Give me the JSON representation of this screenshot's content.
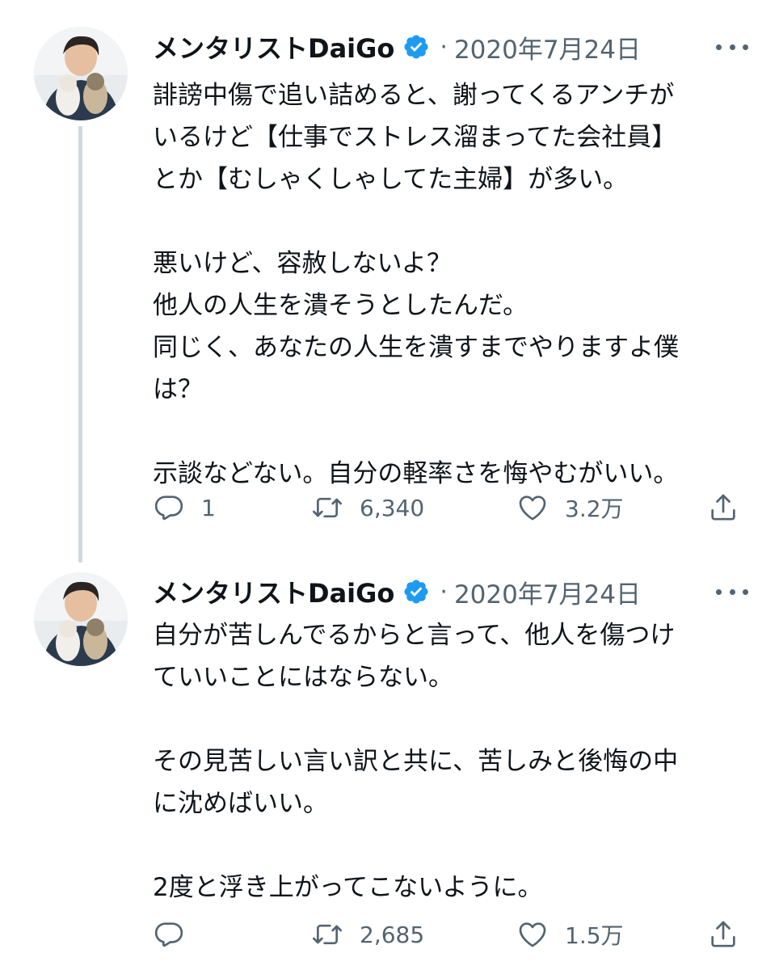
{
  "tweets": [
    {
      "author": "メンタリストDaiGo",
      "separator": "·",
      "date": "2020年7月24日",
      "lines": [
        "誹謗中傷で追い詰めると、謝ってくるアンチが",
        "いるけど【仕事でストレス溜まってた会社員】",
        "とか【むしゃくしゃしてた主婦】が多い。",
        "",
        "悪いけど、容赦しないよ？",
        "他人の人生を潰そうとしたんだ。",
        "同じく、あなたの人生を潰すまでやりますよ僕",
        "は？",
        "",
        "示談などない。自分の軽率さを悔やむがいい。"
      ],
      "replies": "1",
      "retweets": "6,340",
      "likes": "3.2万"
    },
    {
      "author": "メンタリストDaiGo",
      "separator": "·",
      "date": "2020年7月24日",
      "lines": [
        "自分が苦しんでるからと言って、他人を傷つけ",
        "ていいことにはならない。",
        "",
        "その見苦しい言い訳と共に、苦しみと後悔の中",
        "に沈めばいい。",
        "",
        "2度と浮き上がってこないように。"
      ],
      "replies": "",
      "retweets": "2,685",
      "likes": "1.5万"
    }
  ],
  "icons": {
    "reply": "comment-bubble-icon",
    "retweet": "retweet-icon",
    "like": "heart-icon",
    "share": "share-upload-icon",
    "verified": "verified-badge-icon",
    "more": "more-dots-icon"
  },
  "colors": {
    "text": "#0f1419",
    "secondary": "#536471",
    "verified": "#1d9bf0",
    "thread_line": "#cfd9de"
  }
}
